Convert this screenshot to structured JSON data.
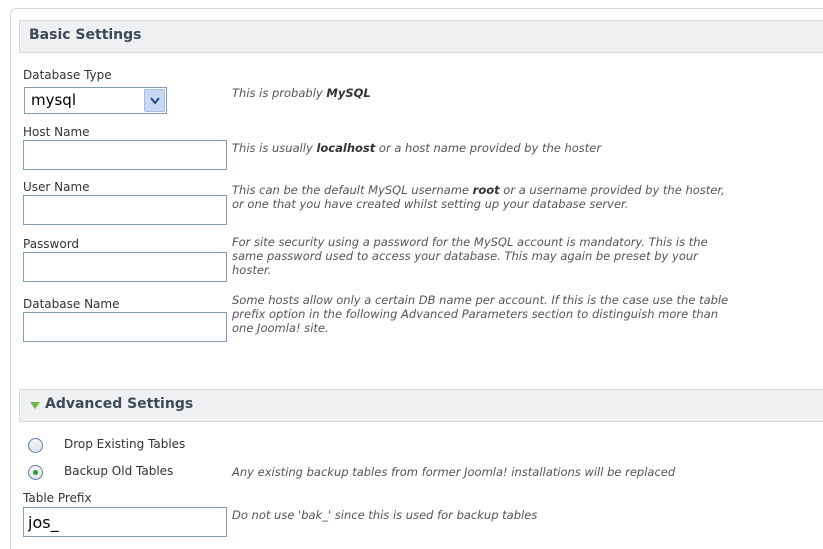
{
  "basic": {
    "title": "Basic Settings",
    "db_type": {
      "label": "Database Type",
      "value": "mysql",
      "help_pre": "This is probably ",
      "help_bold": "MySQL"
    },
    "host": {
      "label": "Host Name",
      "value": "",
      "help_pre": "This is usually ",
      "help_bold": "localhost",
      "help_post": " or a host name provided by the hoster"
    },
    "user": {
      "label": "User Name",
      "value": "",
      "help_pre": "This can be the default MySQL username ",
      "help_bold": "root",
      "help_post": " or a username provided by the hoster,",
      "help_line2": "or one that you have created whilst setting up your database server."
    },
    "password": {
      "label": "Password",
      "value": "",
      "help_line1": "For site security using a password for the MySQL account is mandatory. This is the",
      "help_line2": "same password used to access your database. This may again be preset by your",
      "help_line3": "hoster."
    },
    "db_name": {
      "label": "Database Name",
      "value": "",
      "help_line1": "Some hosts allow only a certain DB name per account. If this is the case use the table",
      "help_line2": "prefix option in the following Advanced Parameters section to distinguish more than",
      "help_line3": "one Joomla! site."
    }
  },
  "advanced": {
    "title": "Advanced Settings",
    "options": [
      {
        "label": "Drop Existing Tables",
        "selected": false,
        "help": ""
      },
      {
        "label": "Backup Old Tables",
        "selected": true,
        "help": "Any existing backup tables from former Joomla! installations will be replaced"
      }
    ],
    "prefix": {
      "label": "Table Prefix",
      "value": "jos_",
      "help": "Do not use 'bak_' since this is used for backup tables"
    }
  }
}
